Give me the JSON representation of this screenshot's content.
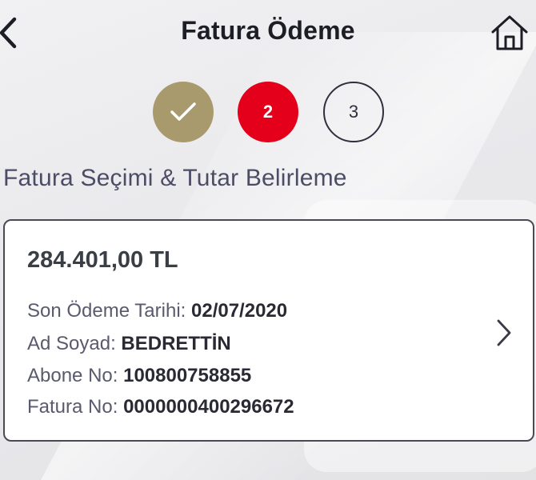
{
  "header": {
    "title": "Fatura Ödeme",
    "back_icon": "chevron-left-icon",
    "home_icon": "home-icon"
  },
  "steps": [
    {
      "label": "",
      "state": "completed",
      "icon": "check-icon",
      "color": "#a89a6c"
    },
    {
      "label": "2",
      "state": "active",
      "color": "#e4001b"
    },
    {
      "label": "3",
      "state": "pending"
    }
  ],
  "section": {
    "title": "Fatura Seçimi & Tutar Belirleme"
  },
  "invoice": {
    "amount": "284.401,00 TL",
    "due_date_label": "Son Ödeme Tarihi:",
    "due_date": "02/07/2020",
    "name_label": "Ad Soyad:",
    "name": "BEDRETTİN",
    "subscriber_label": "Abone No:",
    "subscriber_no": "100800758855",
    "invoice_label": "Fatura No:",
    "invoice_no": "0000000400296672",
    "chevron_icon": "chevron-right-icon"
  }
}
